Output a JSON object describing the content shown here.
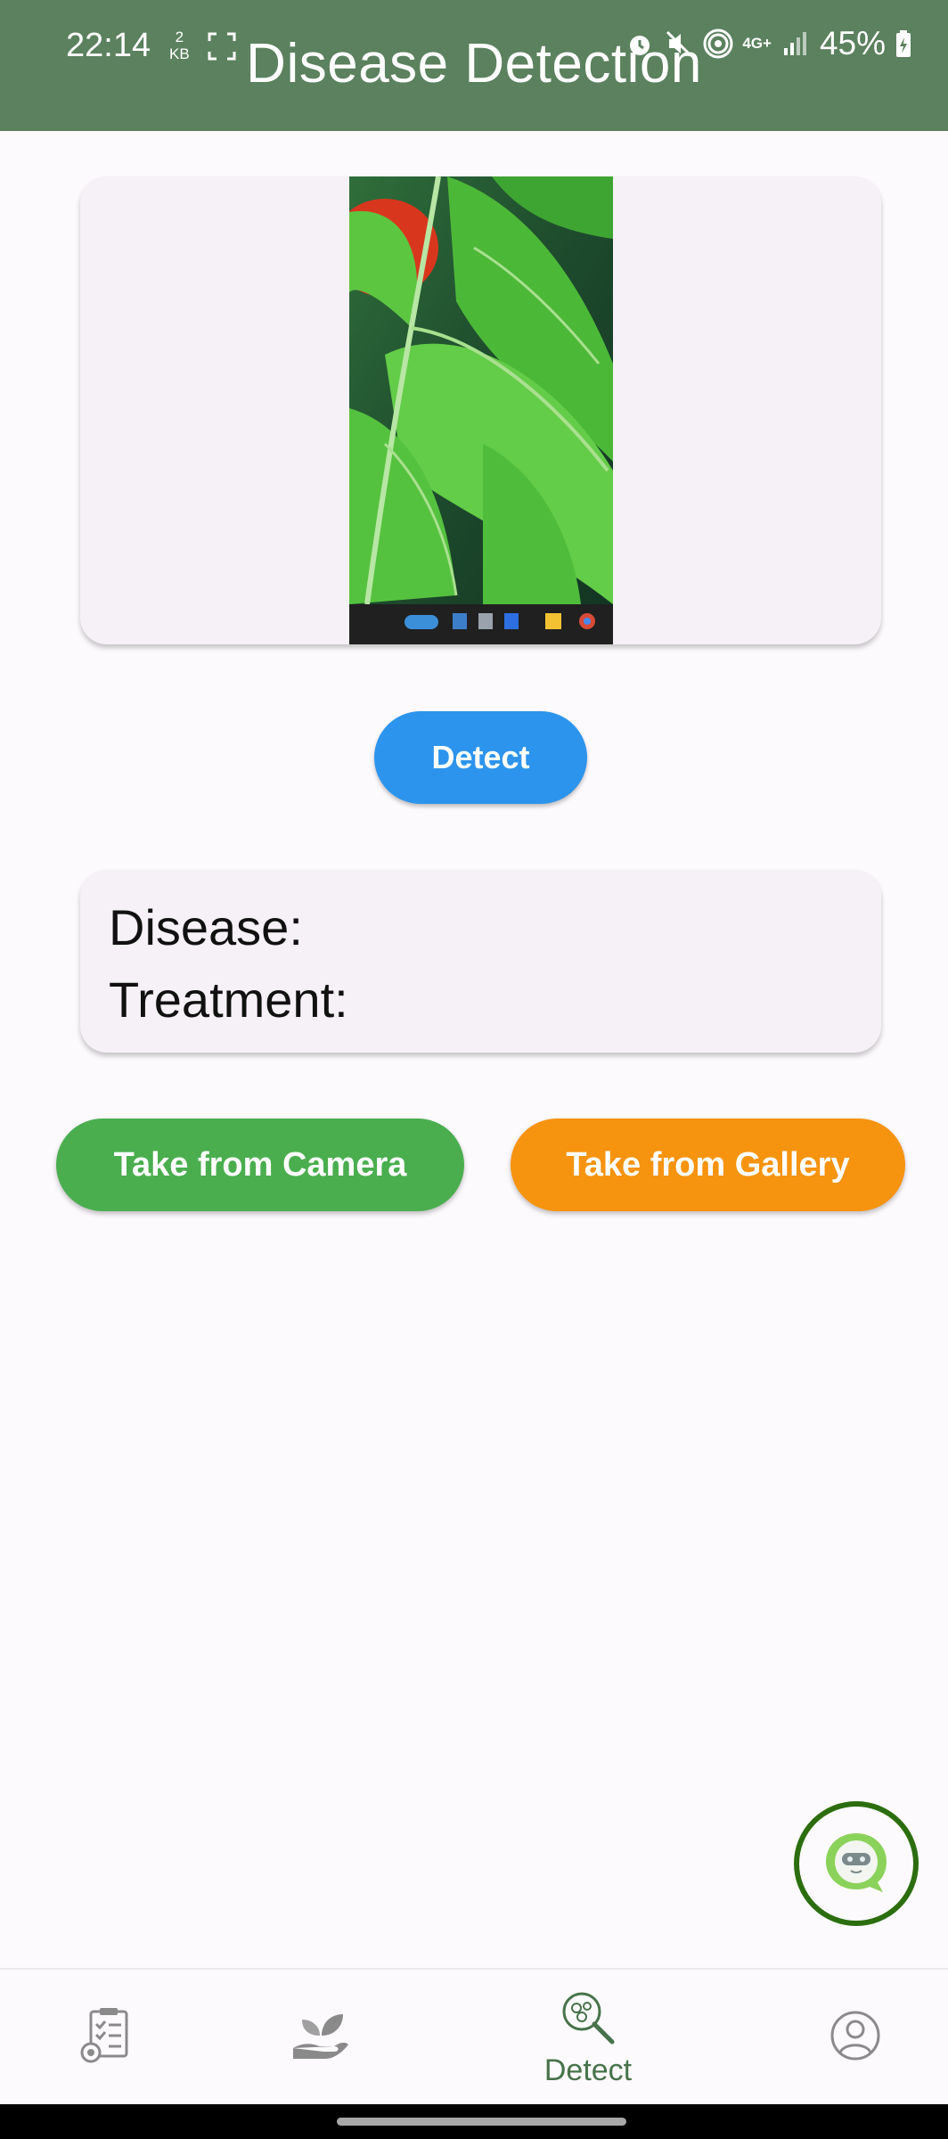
{
  "status_bar": {
    "time": "22:14",
    "data_speed_value": "2",
    "data_speed_unit": "KB",
    "network": "4G+",
    "battery": "45%",
    "icons": [
      "screenshot-icon",
      "alarm-icon",
      "mute-icon",
      "hotspot-icon",
      "network-icon",
      "signal-icon",
      "battery-icon"
    ]
  },
  "header": {
    "title": "Disease Detection"
  },
  "image_card": {
    "photo_icon": "leaf-photo"
  },
  "detect_button": {
    "label": "Detect"
  },
  "result": {
    "disease_label": "Disease:",
    "treatment_label": "Treatment:"
  },
  "actions": {
    "camera_label": "Take from Camera",
    "gallery_label": "Take from Gallery"
  },
  "chat_fab": {
    "icon": "chatbot-icon"
  },
  "bottom_nav": {
    "items": [
      {
        "icon": "checklist-icon",
        "label": ""
      },
      {
        "icon": "plant-hand-icon",
        "label": ""
      },
      {
        "icon": "detect-icon",
        "label": "Detect"
      },
      {
        "icon": "profile-icon",
        "label": ""
      }
    ],
    "active_color": "#47734a"
  },
  "colors": {
    "appbar": "#5b815e",
    "detect_button": "#2c94ec",
    "camera_button": "#4aae4f",
    "gallery_button": "#f6930f",
    "chat_ring": "#2c6e0f"
  }
}
